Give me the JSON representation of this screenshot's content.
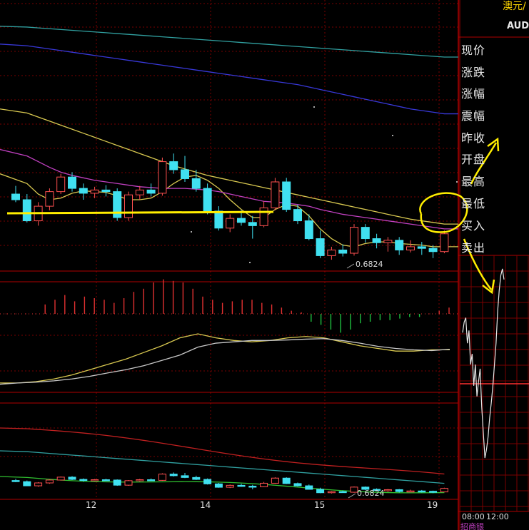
{
  "colors": {
    "background": "#000000",
    "grid": "#7a0000",
    "border": "#b00000",
    "up": "#ff5050",
    "down": "#40e0f0",
    "ma_yellow": "#d8c850",
    "ma_purple": "#c040c0",
    "ma_blue": "#3838d8",
    "ma_teal": "#30a0a0",
    "macd_pos": "#e03030",
    "macd_neg": "#20c040",
    "annotation": "#ffee00"
  },
  "header": {
    "instrument": "澳元/",
    "symbol": "AUDU"
  },
  "quote_panel": {
    "labels": [
      "现价",
      "涨跌",
      "涨幅",
      "震幅",
      "昨收",
      "开盘",
      "最高",
      "最低",
      "买入",
      "卖出"
    ]
  },
  "annotations": {
    "main_low": "0.6824",
    "lower_low": "0.6824"
  },
  "x_axis": {
    "ticks": [
      "12",
      "14",
      "15",
      "19"
    ]
  },
  "intraday": {
    "ticks": [
      "08:00",
      "12:00"
    ],
    "footer": "招商银"
  },
  "chart_data": [
    {
      "type": "candlestick",
      "panel": "main",
      "series_name": "AUD/USD",
      "low_label": "0.6824",
      "ohlc": [
        [
          0.6905,
          0.6915,
          0.6895,
          0.6898
        ],
        [
          0.6898,
          0.6905,
          0.687,
          0.6872
        ],
        [
          0.6872,
          0.6895,
          0.6866,
          0.689
        ],
        [
          0.689,
          0.6912,
          0.6885,
          0.6908
        ],
        [
          0.6908,
          0.693,
          0.6905,
          0.6926
        ],
        [
          0.6926,
          0.6932,
          0.6908,
          0.6912
        ],
        [
          0.6912,
          0.6918,
          0.6898,
          0.6906
        ],
        [
          0.6906,
          0.6914,
          0.69,
          0.691
        ],
        [
          0.691,
          0.6916,
          0.6902,
          0.6908
        ],
        [
          0.6908,
          0.6912,
          0.6872,
          0.6876
        ],
        [
          0.6876,
          0.6908,
          0.6872,
          0.6904
        ],
        [
          0.6904,
          0.6915,
          0.6898,
          0.691
        ],
        [
          0.691,
          0.6918,
          0.6902,
          0.6906
        ],
        [
          0.6906,
          0.695,
          0.6903,
          0.6945
        ],
        [
          0.6945,
          0.6955,
          0.693,
          0.6935
        ],
        [
          0.6935,
          0.6952,
          0.692,
          0.6924
        ],
        [
          0.6924,
          0.6935,
          0.6908,
          0.6912
        ],
        [
          0.6912,
          0.6918,
          0.688,
          0.6884
        ],
        [
          0.6884,
          0.689,
          0.686,
          0.6863
        ],
        [
          0.6863,
          0.688,
          0.6858,
          0.6875
        ],
        [
          0.6875,
          0.6885,
          0.6866,
          0.687
        ],
        [
          0.687,
          0.6878,
          0.685,
          0.6866
        ],
        [
          0.6866,
          0.6896,
          0.6864,
          0.6888
        ],
        [
          0.6888,
          0.6925,
          0.6885,
          0.692
        ],
        [
          0.692,
          0.6925,
          0.6883,
          0.6886
        ],
        [
          0.6886,
          0.6892,
          0.6868,
          0.6872
        ],
        [
          0.6872,
          0.688,
          0.6848,
          0.685
        ],
        [
          0.685,
          0.686,
          0.6826,
          0.6829
        ],
        [
          0.6829,
          0.684,
          0.6824,
          0.6836
        ],
        [
          0.6836,
          0.6843,
          0.6828,
          0.6832
        ],
        [
          0.6832,
          0.6868,
          0.6829,
          0.6864
        ],
        [
          0.6864,
          0.6868,
          0.6845,
          0.685
        ],
        [
          0.685,
          0.6856,
          0.6838,
          0.6845
        ],
        [
          0.6845,
          0.6852,
          0.6834,
          0.6848
        ],
        [
          0.6848,
          0.6852,
          0.683,
          0.6836
        ],
        [
          0.6836,
          0.6848,
          0.6833,
          0.684
        ],
        [
          0.684,
          0.6846,
          0.683,
          0.6838
        ],
        [
          0.6838,
          0.6842,
          0.6826,
          0.6834
        ],
        [
          0.6834,
          0.686,
          0.6832,
          0.6856
        ]
      ],
      "ma_lines": [
        {
          "color": "ma_yellow",
          "values": [
            0.693,
            0.6918,
            0.6905,
            0.6898,
            0.69,
            0.6906,
            0.6909,
            0.6908,
            0.6907,
            0.6903,
            0.6898,
            0.6898,
            0.69,
            0.6908,
            0.6918,
            0.6926,
            0.6928,
            0.6922,
            0.6912,
            0.6898,
            0.6886,
            0.6876,
            0.6876,
            0.6886,
            0.6892,
            0.689,
            0.6878,
            0.6862,
            0.685,
            0.6842,
            0.684,
            0.6844,
            0.6846,
            0.6846,
            0.6844,
            0.6843,
            0.6842,
            0.684,
            0.684
          ]
        },
        {
          "color": "ma_purple",
          "values": [
            0.696,
            0.6952,
            0.6945,
            0.6938,
            0.6932,
            0.6928,
            0.6925,
            0.6922,
            0.692,
            0.6918,
            0.6916,
            0.6914,
            0.6913,
            0.6912,
            0.6912,
            0.6912,
            0.6911,
            0.691,
            0.6908,
            0.6905,
            0.6902,
            0.6899,
            0.6896,
            0.6895,
            0.6894,
            0.6892,
            0.689,
            0.6886,
            0.6883,
            0.688,
            0.6878,
            0.6876,
            0.6874,
            0.6872,
            0.687,
            0.6868,
            0.6866,
            0.6864,
            0.6862
          ]
        },
        {
          "color": "ma_yellow",
          "values": [
            0.701,
            0.7005,
            0.7,
            0.6995,
            0.699,
            0.6985,
            0.698,
            0.6975,
            0.697,
            0.6965,
            0.696,
            0.6955,
            0.695,
            0.6945,
            0.694,
            0.6936,
            0.6932,
            0.6928,
            0.6925,
            0.6922,
            0.6919,
            0.6916,
            0.6913,
            0.691,
            0.6907,
            0.6904,
            0.6901,
            0.6898,
            0.6895,
            0.6892,
            0.6889,
            0.6886,
            0.6883,
            0.688,
            0.6877,
            0.6874,
            0.6872,
            0.687,
            0.6868
          ]
        },
        {
          "color": "ma_blue",
          "values": [
            0.709,
            0.7088,
            0.7086,
            0.7084,
            0.7082,
            0.708,
            0.7078,
            0.7076,
            0.7074,
            0.7072,
            0.707,
            0.7068,
            0.7066,
            0.7064,
            0.7062,
            0.706,
            0.7058,
            0.7056,
            0.7054,
            0.7052,
            0.705,
            0.7048,
            0.7046,
            0.7044,
            0.7042,
            0.704,
            0.7037,
            0.7034,
            0.7031,
            0.7028,
            0.7025,
            0.7022,
            0.7019,
            0.7016,
            0.7013,
            0.701,
            0.7008,
            0.7006,
            0.7004
          ]
        },
        {
          "color": "ma_teal",
          "values": [
            0.7112,
            0.7111,
            0.711,
            0.7109,
            0.7108,
            0.7107,
            0.7106,
            0.7105,
            0.7104,
            0.7103,
            0.7102,
            0.7101,
            0.71,
            0.7099,
            0.7098,
            0.7097,
            0.7096,
            0.7095,
            0.7094,
            0.7093,
            0.7092,
            0.7091,
            0.709,
            0.7089,
            0.7088,
            0.7087,
            0.7086,
            0.7085,
            0.7084,
            0.7083,
            0.7082,
            0.7081,
            0.708,
            0.7079,
            0.7078,
            0.7077,
            0.7076,
            0.7075,
            0.7074
          ]
        }
      ],
      "ylim": [
        0.681,
        0.714
      ]
    },
    {
      "type": "bar",
      "panel": "macd_histogram",
      "values": [
        0,
        0,
        0,
        0,
        0.6,
        0.9,
        1.2,
        0.8,
        1.1,
        1.0,
        0.9,
        0.7,
        1.0,
        1.4,
        1.6,
        2.0,
        2.2,
        2.1,
        2.0,
        1.6,
        1.1,
        0.9,
        0.7,
        0.8,
        0.9,
        0.9,
        0.7,
        0.6,
        0.4,
        0.2,
        0.1,
        -0.5,
        -0.7,
        -1.0,
        -1.2,
        -1.0,
        -0.6,
        -0.5,
        -0.4,
        -0.4,
        -0.3,
        -0.2,
        -0.2,
        0,
        0.2,
        0.4
      ],
      "ylim": [
        -1.5,
        2.5
      ]
    },
    {
      "type": "line",
      "panel": "macd_lines",
      "series": [
        {
          "color": "ma_yellow",
          "values": [
            -1.0,
            -1.0,
            -0.95,
            -0.85,
            -0.7,
            -0.5,
            -0.3,
            -0.1,
            0.15,
            0.4,
            0.7,
            0.85,
            0.7,
            0.6,
            0.55,
            0.6,
            0.7,
            0.75,
            0.7,
            0.55,
            0.4,
            0.3,
            0.2,
            0.2,
            0.25,
            0.25
          ]
        },
        {
          "color": "#c8c8c8",
          "values": [
            -1.05,
            -1.0,
            -0.97,
            -0.92,
            -0.85,
            -0.75,
            -0.62,
            -0.5,
            -0.35,
            -0.15,
            0.05,
            0.35,
            0.5,
            0.55,
            0.6,
            0.6,
            0.62,
            0.65,
            0.67,
            0.6,
            0.5,
            0.38,
            0.3,
            0.25,
            0.22,
            0.27
          ]
        }
      ],
      "ylim": [
        -1.3,
        1.2
      ]
    },
    {
      "type": "line",
      "panel": "intraday",
      "values": [
        0.6885,
        0.689,
        0.6892,
        0.688,
        0.6886,
        0.687,
        0.6875,
        0.686,
        0.687,
        0.6855,
        0.6862,
        0.6868,
        0.685,
        0.6838,
        0.6826,
        0.683,
        0.6836,
        0.6845,
        0.6852,
        0.686,
        0.687,
        0.688,
        0.6895,
        0.6905,
        0.6912,
        0.6915,
        0.691
      ],
      "ylim": [
        0.682,
        0.692
      ]
    }
  ]
}
